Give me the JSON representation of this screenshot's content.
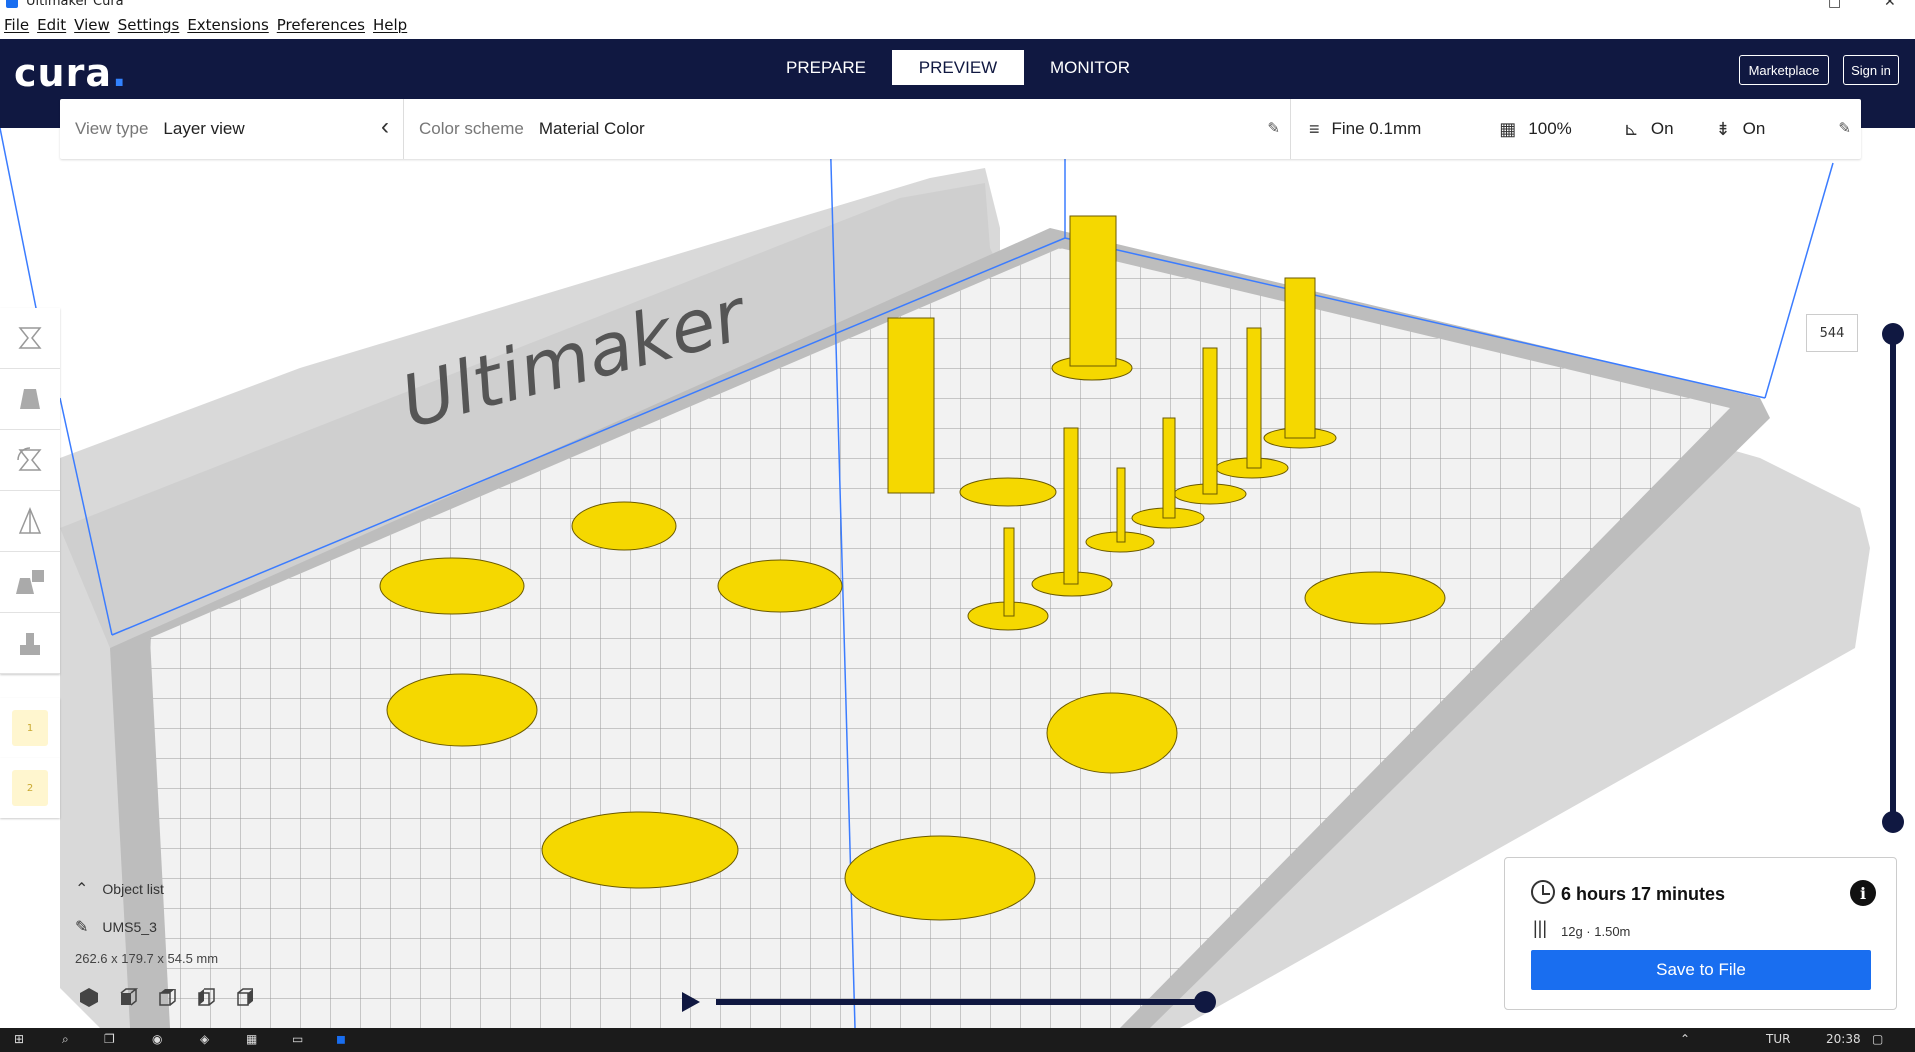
{
  "window": {
    "title": "Ultimaker Cura"
  },
  "menu": {
    "items": [
      "File",
      "Edit",
      "View",
      "Settings",
      "Extensions",
      "Preferences",
      "Help"
    ]
  },
  "header": {
    "logo": "cura",
    "tabs": [
      {
        "label": "PREPARE",
        "active": false
      },
      {
        "label": "PREVIEW",
        "active": true
      },
      {
        "label": "MONITOR",
        "active": false
      }
    ],
    "marketplace_label": "Marketplace",
    "signin_label": "Sign in",
    "accent": "#101841",
    "brand_blue": "#196ef0"
  },
  "stagebar": {
    "view_type_label": "View type",
    "view_type_value": "Layer view",
    "color_scheme_label": "Color scheme",
    "color_scheme_value": "Material Color",
    "profile": "Fine 0.1mm",
    "infill": "100%",
    "support": "On",
    "adhesion": "On"
  },
  "viewport": {
    "bed_brand": "Ultimaker",
    "material_color": "#f5d800"
  },
  "layer_slider": {
    "current_layer": "544"
  },
  "object_list": {
    "header": "Object list",
    "object_name": "UMS5_3",
    "dimensions": "262.6 x 179.7 x 54.5 mm"
  },
  "print_info": {
    "time": "6 hours 17 minutes",
    "usage": "12g · 1.50m",
    "save_label": "Save to File"
  },
  "taskbar": {
    "lang": "TUR",
    "clock": "20:38"
  }
}
